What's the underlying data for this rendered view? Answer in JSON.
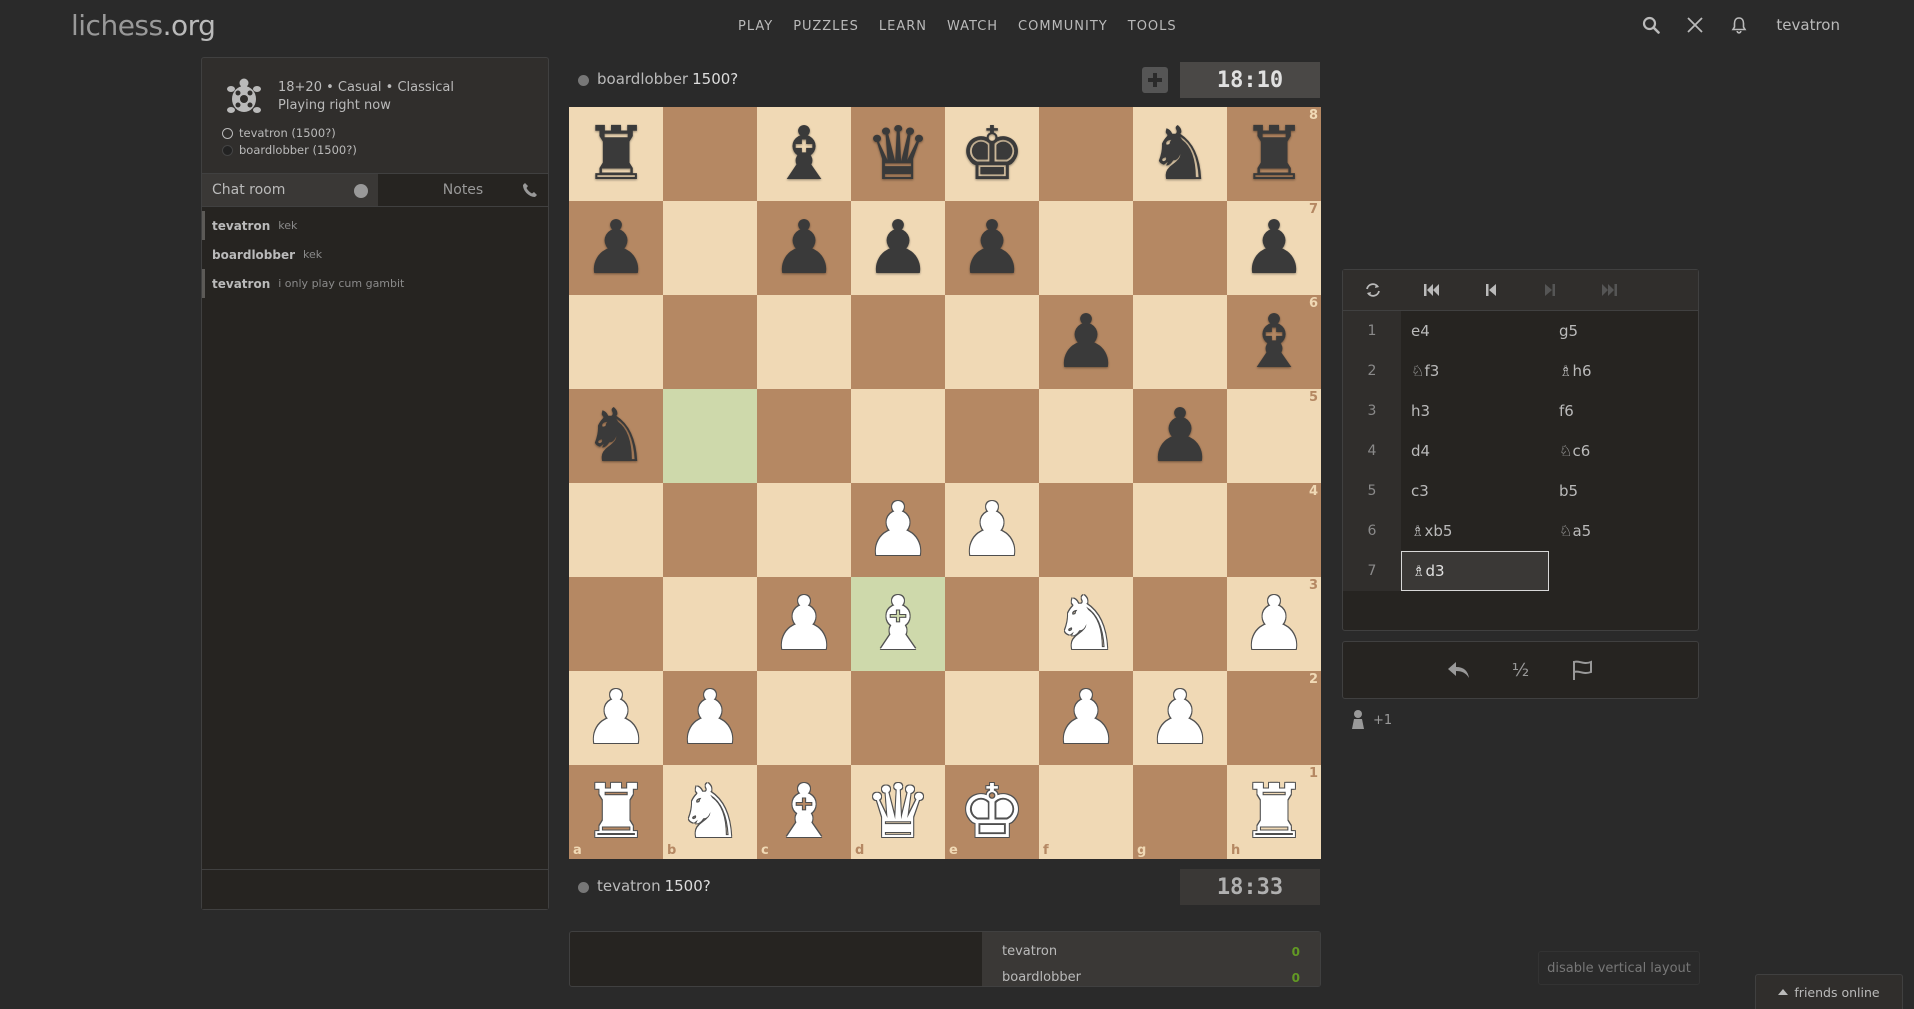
{
  "header": {
    "logo_name": "lichess",
    "logo_tld": ".org",
    "nav": [
      "PLAY",
      "PUZZLES",
      "LEARN",
      "WATCH",
      "COMMUNITY",
      "TOOLS"
    ],
    "username": "tevatron"
  },
  "game_info": {
    "line1": "18+20 • Casual • Classical",
    "line2": "Playing right now",
    "white_player": "tevatron (1500?)",
    "black_player": "boardlobber (1500?)"
  },
  "chat": {
    "tab_chat": "Chat room",
    "tab_notes": "Notes",
    "messages": [
      {
        "user": "tevatron",
        "text": "kek"
      },
      {
        "user": "boardlobber",
        "text": "kek"
      },
      {
        "user": "tevatron",
        "text": "i only play cum gambit"
      }
    ]
  },
  "top_player": {
    "name": "boardlobber",
    "rating": "1500?",
    "clock_min": "18",
    "clock_sec": "10"
  },
  "bottom_player": {
    "name": "tevatron",
    "rating": "1500?",
    "clock_min": "18",
    "clock_sec": "33"
  },
  "board": {
    "ranks": [
      "8",
      "7",
      "6",
      "5",
      "4",
      "3",
      "2",
      "1"
    ],
    "files": [
      "a",
      "b",
      "c",
      "d",
      "e",
      "f",
      "g",
      "h"
    ],
    "position": [
      [
        "br",
        "",
        "bb",
        "bq",
        "bk",
        "",
        "bn",
        "br"
      ],
      [
        "bp",
        "",
        "bp",
        "bp",
        "bp",
        "",
        "",
        "bp"
      ],
      [
        "",
        "",
        "",
        "",
        "",
        "bp",
        "",
        "bb"
      ],
      [
        "bn",
        "",
        "",
        "",
        "",
        "",
        "bp",
        ""
      ],
      [
        "",
        "",
        "",
        "wp",
        "wp",
        "",
        "",
        ""
      ],
      [
        "",
        "",
        "wp",
        "wb",
        "",
        "wn",
        "",
        "wp"
      ],
      [
        "wp",
        "wp",
        "",
        "",
        "",
        "wp",
        "wp",
        ""
      ],
      [
        "wr",
        "wn",
        "wb",
        "wq",
        "wk",
        "",
        "",
        "wr"
      ]
    ],
    "highlight": [
      "b5",
      "d3"
    ]
  },
  "moves": [
    {
      "n": "1",
      "w": "e4",
      "b": "g5"
    },
    {
      "n": "2",
      "w": "♘f3",
      "b": "♗h6"
    },
    {
      "n": "3",
      "w": "h3",
      "b": "f6"
    },
    {
      "n": "4",
      "w": "d4",
      "b": "♘c6"
    },
    {
      "n": "5",
      "w": "c3",
      "b": "b5"
    },
    {
      "n": "6",
      "w": "♗xb5",
      "b": "♘a5"
    },
    {
      "n": "7",
      "w": "♗d3",
      "b": ""
    }
  ],
  "actions": {
    "draw_label": "½"
  },
  "spectators": {
    "count": "+1"
  },
  "crosstable": {
    "rows": [
      {
        "name": "tevatron",
        "score": "0"
      },
      {
        "name": "boardlobber",
        "score": "0"
      }
    ]
  },
  "vertical_layout_label": "disable vertical layout",
  "friends_label": "friends online",
  "colors": {
    "light_square": "#f0d9b5",
    "dark_square": "#b58863",
    "highlight": "#ced9ab"
  }
}
